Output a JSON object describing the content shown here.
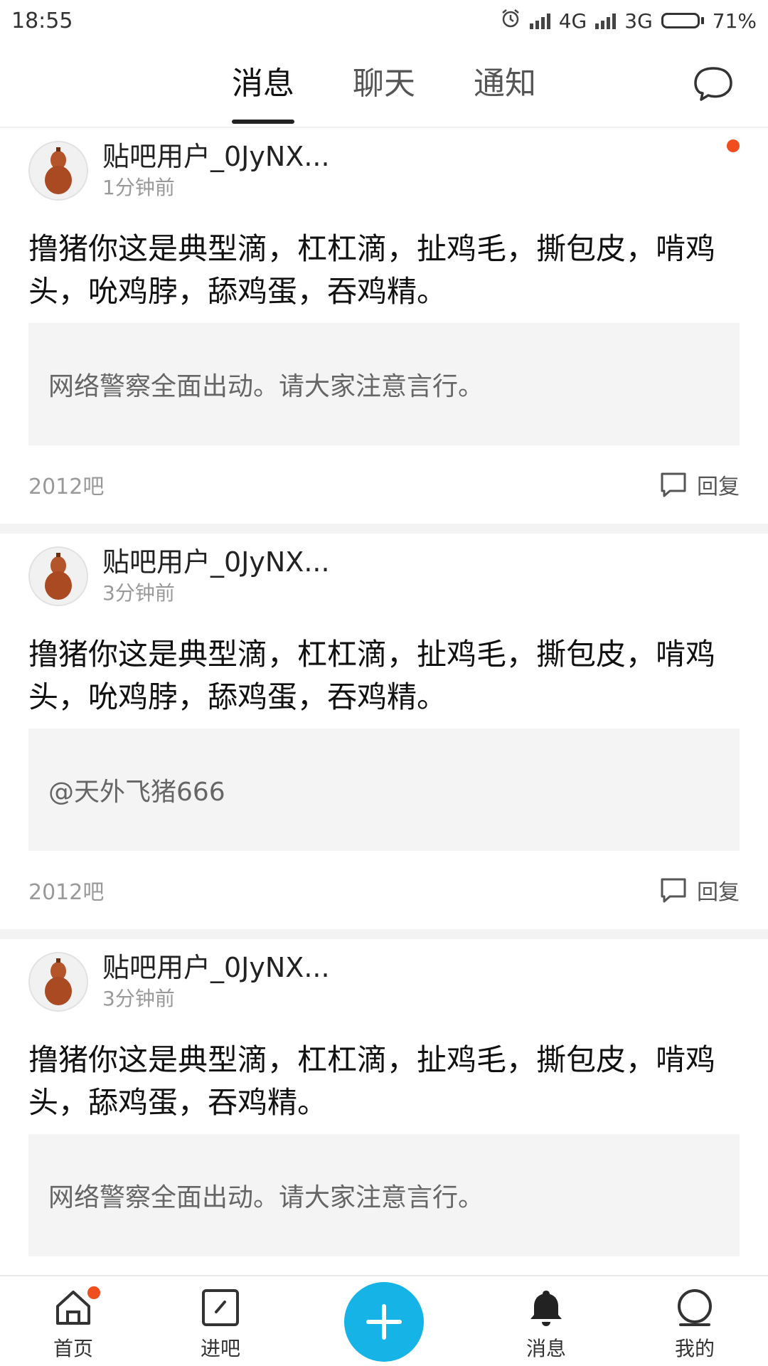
{
  "status": {
    "time": "18:55",
    "net1": "4G",
    "net2": "3G",
    "battery": "71%",
    "battery_level": 0.71
  },
  "nav": {
    "tabs": [
      "消息",
      "聊天",
      "通知"
    ],
    "active_tab": 0,
    "chat_icon": "chat-bubble-icon"
  },
  "posts": [
    {
      "username": "贴吧用户_0JyNX...",
      "time": "1分钟前",
      "unread": true,
      "content": "撸猪你这是典型滴，杠杠滴，扯鸡毛，撕包皮，啃鸡头，吮鸡脖，舔鸡蛋，吞鸡精。",
      "quote": "网络警察全面出动。请大家注意言行。",
      "forum": "2012吧",
      "reply_label": "回复"
    },
    {
      "username": "贴吧用户_0JyNX...",
      "time": "3分钟前",
      "unread": false,
      "content": "撸猪你这是典型滴，杠杠滴，扯鸡毛，撕包皮，啃鸡头，吮鸡脖，舔鸡蛋，吞鸡精。",
      "quote": "@天外飞猪666",
      "forum": "2012吧",
      "reply_label": "回复"
    },
    {
      "username": "贴吧用户_0JyNX...",
      "time": "3分钟前",
      "unread": false,
      "content": "撸猪你这是典型滴，杠杠滴，扯鸡毛，撕包皮，啃鸡头，舔鸡蛋，吞鸡精。",
      "quote": "网络警察全面出动。请大家注意言行。",
      "forum": "",
      "reply_label": ""
    }
  ],
  "bottom_nav": {
    "home": "首页",
    "enter": "进吧",
    "messages": "消息",
    "me": "我的",
    "post_icon": "plus-icon"
  },
  "colors": {
    "accent": "#16b4e6",
    "badge": "#f04e1e"
  }
}
